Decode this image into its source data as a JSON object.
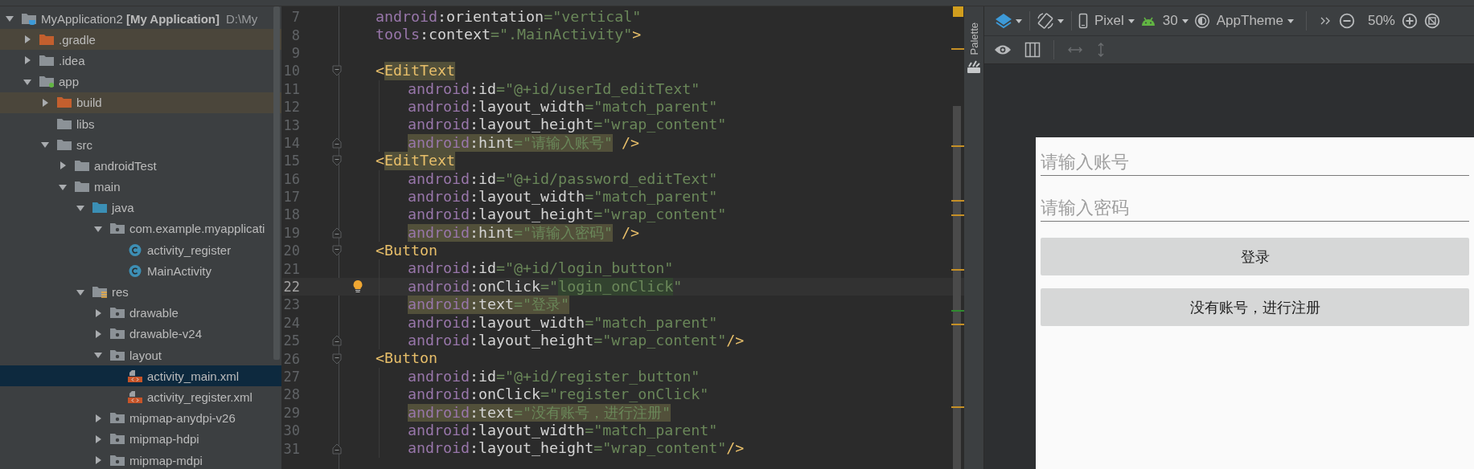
{
  "project_tree": [
    {
      "label": "MyApplication2 **[My Application]**",
      "path": "D:\\My",
      "kind": "project",
      "expanded": true,
      "selected": false,
      "excluded": false,
      "children": [
        {
          "label": ".gradle",
          "kind": "folder",
          "expanded": false,
          "selected": false,
          "excluded": true
        },
        {
          "label": ".idea",
          "kind": "folder",
          "expanded": false,
          "selected": false,
          "excluded": false
        },
        {
          "label": "app",
          "kind": "module",
          "expanded": true,
          "selected": false,
          "excluded": false,
          "children": [
            {
              "label": "build",
              "kind": "folder",
              "expanded": false,
              "selected": false,
              "excluded": true
            },
            {
              "label": "libs",
              "kind": "folder",
              "selected": false,
              "excluded": false
            },
            {
              "label": "src",
              "kind": "folder",
              "expanded": true,
              "selected": false,
              "excluded": false,
              "children": [
                {
                  "label": "androidTest",
                  "kind": "folder",
                  "expanded": false,
                  "selected": false,
                  "excluded": false
                },
                {
                  "label": "main",
                  "kind": "folder",
                  "expanded": true,
                  "selected": false,
                  "excluded": false,
                  "children": [
                    {
                      "label": "java",
                      "kind": "source-folder",
                      "expanded": true,
                      "selected": false,
                      "excluded": false,
                      "children": [
                        {
                          "label": "com.example.myapplicati",
                          "kind": "package",
                          "expanded": true,
                          "selected": false,
                          "excluded": false,
                          "children": [
                            {
                              "label": "activity_register",
                              "kind": "class",
                              "selected": false,
                              "excluded": false
                            },
                            {
                              "label": "MainActivity",
                              "kind": "class",
                              "selected": false,
                              "excluded": false
                            }
                          ]
                        }
                      ]
                    },
                    {
                      "label": "res",
                      "kind": "resource-folder",
                      "expanded": true,
                      "selected": false,
                      "excluded": false,
                      "children": [
                        {
                          "label": "drawable",
                          "kind": "package",
                          "expanded": false,
                          "selected": false,
                          "excluded": false
                        },
                        {
                          "label": "drawable-v24",
                          "kind": "package",
                          "expanded": false,
                          "selected": false,
                          "excluded": false
                        },
                        {
                          "label": "layout",
                          "kind": "package",
                          "expanded": true,
                          "selected": false,
                          "excluded": false,
                          "children": [
                            {
                              "label": "activity_main.xml",
                              "kind": "layout-file",
                              "selected": true,
                              "excluded": false
                            },
                            {
                              "label": "activity_register.xml",
                              "kind": "layout-file",
                              "selected": false,
                              "excluded": false
                            }
                          ]
                        },
                        {
                          "label": "mipmap-anydpi-v26",
                          "kind": "package",
                          "expanded": false,
                          "selected": false,
                          "excluded": false
                        },
                        {
                          "label": "mipmap-hdpi",
                          "kind": "package",
                          "expanded": false,
                          "selected": false,
                          "excluded": false
                        },
                        {
                          "label": "mipmap-mdpi",
                          "kind": "package",
                          "expanded": false,
                          "selected": false,
                          "excluded": false
                        }
                      ]
                    }
                  ]
                }
              ]
            }
          ]
        }
      ]
    }
  ],
  "code": {
    "lines": [
      {
        "number": "7",
        "current": false,
        "segments": [
          {
            "kind": "ns",
            "text": "android",
            "highlight": false
          },
          {
            "kind": "plain",
            "text": ":orientation",
            "highlight": false
          },
          {
            "kind": "str",
            "text": "=\"vertical\"",
            "highlight": false
          }
        ]
      },
      {
        "number": "8",
        "current": false,
        "segments": [
          {
            "kind": "ns",
            "text": "tools",
            "highlight": false
          },
          {
            "kind": "plain",
            "text": ":context",
            "highlight": false
          },
          {
            "kind": "str",
            "text": "=\".MainActivity\"",
            "highlight": false
          },
          {
            "kind": "tag",
            "text": ">",
            "highlight": false
          }
        ]
      },
      {
        "number": "9",
        "current": false
      },
      {
        "number": "10",
        "current": false,
        "fold_start": true,
        "segments": [
          {
            "kind": "tag",
            "text": "<",
            "highlight": false
          },
          {
            "kind": "tag",
            "text": "EditText",
            "highlight": true
          }
        ],
        "children": [
          {
            "number": "11",
            "current": false,
            "segments": [
              {
                "kind": "ns",
                "text": "android",
                "highlight": false
              },
              {
                "kind": "plain",
                "text": ":id",
                "highlight": false
              },
              {
                "kind": "str",
                "text": "=\"@+id/userId_editText\"",
                "highlight": false
              }
            ]
          },
          {
            "number": "12",
            "current": false,
            "segments": [
              {
                "kind": "ns",
                "text": "android",
                "highlight": false
              },
              {
                "kind": "plain",
                "text": ":layout_width",
                "highlight": false
              },
              {
                "kind": "str",
                "text": "=\"match_parent\"",
                "highlight": false
              }
            ]
          },
          {
            "number": "13",
            "current": false,
            "segments": [
              {
                "kind": "ns",
                "text": "android",
                "highlight": false
              },
              {
                "kind": "plain",
                "text": ":layout_height",
                "highlight": false
              },
              {
                "kind": "str",
                "text": "=\"wrap_content\"",
                "highlight": false
              }
            ]
          },
          {
            "number": "14",
            "current": false,
            "fold_end": true,
            "segments": [
              {
                "kind": "ns",
                "text": "android",
                "highlight": true
              },
              {
                "kind": "plain",
                "text": ":hint",
                "highlight": true
              },
              {
                "kind": "str",
                "text": "=\"请输入账号\"",
                "highlight": true
              },
              {
                "kind": "tag",
                "text": " />",
                "highlight": false
              }
            ]
          }
        ]
      },
      {
        "number": "15",
        "current": false,
        "fold_start": true,
        "segments": [
          {
            "kind": "tag",
            "text": "<",
            "highlight": false
          },
          {
            "kind": "tag",
            "text": "EditText",
            "highlight": true
          }
        ],
        "children": [
          {
            "number": "16",
            "current": false,
            "segments": [
              {
                "kind": "ns",
                "text": "android",
                "highlight": false
              },
              {
                "kind": "plain",
                "text": ":id",
                "highlight": false
              },
              {
                "kind": "str",
                "text": "=\"@+id/password_editText\"",
                "highlight": false
              }
            ]
          },
          {
            "number": "17",
            "current": false,
            "segments": [
              {
                "kind": "ns",
                "text": "android",
                "highlight": false
              },
              {
                "kind": "plain",
                "text": ":layout_width",
                "highlight": false
              },
              {
                "kind": "str",
                "text": "=\"match_parent\"",
                "highlight": false
              }
            ]
          },
          {
            "number": "18",
            "current": false,
            "segments": [
              {
                "kind": "ns",
                "text": "android",
                "highlight": false
              },
              {
                "kind": "plain",
                "text": ":layout_height",
                "highlight": false
              },
              {
                "kind": "str",
                "text": "=\"wrap_content\"",
                "highlight": false
              }
            ]
          },
          {
            "number": "19",
            "current": false,
            "fold_end": true,
            "segments": [
              {
                "kind": "ns",
                "text": "android",
                "highlight": true
              },
              {
                "kind": "plain",
                "text": ":hint",
                "highlight": true
              },
              {
                "kind": "str",
                "text": "=\"请输入密码\"",
                "highlight": true
              },
              {
                "kind": "tag",
                "text": " />",
                "highlight": false
              }
            ]
          }
        ]
      },
      {
        "number": "20",
        "current": false,
        "fold_start": true,
        "segments": [
          {
            "kind": "tag",
            "text": "<Button",
            "highlight": false
          }
        ],
        "children": [
          {
            "number": "21",
            "current": false,
            "segments": [
              {
                "kind": "ns",
                "text": "android",
                "highlight": false
              },
              {
                "kind": "plain",
                "text": ":id",
                "highlight": false
              },
              {
                "kind": "str",
                "text": "=\"@+id/login_button\"",
                "highlight": false
              }
            ]
          },
          {
            "number": "22",
            "current": true,
            "bulb": true,
            "segments": [
              {
                "kind": "ns",
                "text": "android",
                "highlight": false
              },
              {
                "kind": "plain",
                "text": ":onClick",
                "highlight": false
              },
              {
                "kind": "str",
                "text": "=\"",
                "highlight": false
              },
              {
                "kind": "match",
                "text": "login_onClick",
                "highlight": true
              },
              {
                "kind": "str",
                "text": "\"",
                "highlight": false
              }
            ]
          },
          {
            "number": "23",
            "current": false,
            "segments": [
              {
                "kind": "ns",
                "text": "android",
                "highlight": true
              },
              {
                "kind": "plain",
                "text": ":text",
                "highlight": true
              },
              {
                "kind": "str",
                "text": "=\"登录\"",
                "highlight": true
              }
            ]
          },
          {
            "number": "24",
            "current": false,
            "segments": [
              {
                "kind": "ns",
                "text": "android",
                "highlight": false
              },
              {
                "kind": "plain",
                "text": ":layout_width",
                "highlight": false
              },
              {
                "kind": "str",
                "text": "=\"match_parent\"",
                "highlight": false
              }
            ]
          },
          {
            "number": "25",
            "current": false,
            "fold_end": true,
            "segments": [
              {
                "kind": "ns",
                "text": "android",
                "highlight": false
              },
              {
                "kind": "plain",
                "text": ":layout_height",
                "highlight": false
              },
              {
                "kind": "str",
                "text": "=\"wrap_content\"",
                "highlight": false
              },
              {
                "kind": "tag",
                "text": "/>",
                "highlight": false
              }
            ]
          }
        ]
      },
      {
        "number": "26",
        "current": false,
        "fold_start": true,
        "segments": [
          {
            "kind": "tag",
            "text": "<Button",
            "highlight": false
          }
        ],
        "children": [
          {
            "number": "27",
            "current": false,
            "segments": [
              {
                "kind": "ns",
                "text": "android",
                "highlight": false
              },
              {
                "kind": "plain",
                "text": ":id",
                "highlight": false
              },
              {
                "kind": "str",
                "text": "=\"@+id/register_button\"",
                "highlight": false
              }
            ]
          },
          {
            "number": "28",
            "current": false,
            "segments": [
              {
                "kind": "ns",
                "text": "android",
                "highlight": false
              },
              {
                "kind": "plain",
                "text": ":onClick",
                "highlight": false
              },
              {
                "kind": "str",
                "text": "=\"register_onClick\"",
                "highlight": false
              }
            ]
          },
          {
            "number": "29",
            "current": false,
            "segments": [
              {
                "kind": "ns",
                "text": "android",
                "highlight": true
              },
              {
                "kind": "plain",
                "text": ":text",
                "highlight": true
              },
              {
                "kind": "str",
                "text": "=\"没有账号，进行注册\"",
                "highlight": true
              }
            ]
          },
          {
            "number": "30",
            "current": false,
            "segments": [
              {
                "kind": "ns",
                "text": "android",
                "highlight": false
              },
              {
                "kind": "plain",
                "text": ":layout_width",
                "highlight": false
              },
              {
                "kind": "str",
                "text": "=\"match_parent\"",
                "highlight": false
              }
            ]
          },
          {
            "number": "31",
            "current": false,
            "fold_end": true,
            "segments": [
              {
                "kind": "ns",
                "text": "android",
                "highlight": false
              },
              {
                "kind": "plain",
                "text": ":layout_height",
                "highlight": false
              },
              {
                "kind": "str",
                "text": "=\"wrap_content\"",
                "highlight": false
              },
              {
                "kind": "tag",
                "text": "/>",
                "highlight": false
              }
            ]
          }
        ]
      }
    ]
  },
  "palette": {
    "label": "Palette"
  },
  "design_toolbar": {
    "device": "Pixel",
    "api_level": "30",
    "theme": "AppTheme",
    "zoom": "50%"
  },
  "preview": {
    "fields": [
      {
        "placeholder": "请输入账号"
      },
      {
        "placeholder": "请输入密码"
      }
    ],
    "buttons": [
      {
        "label": "登录"
      },
      {
        "label": "没有账号，进行注册"
      }
    ]
  }
}
